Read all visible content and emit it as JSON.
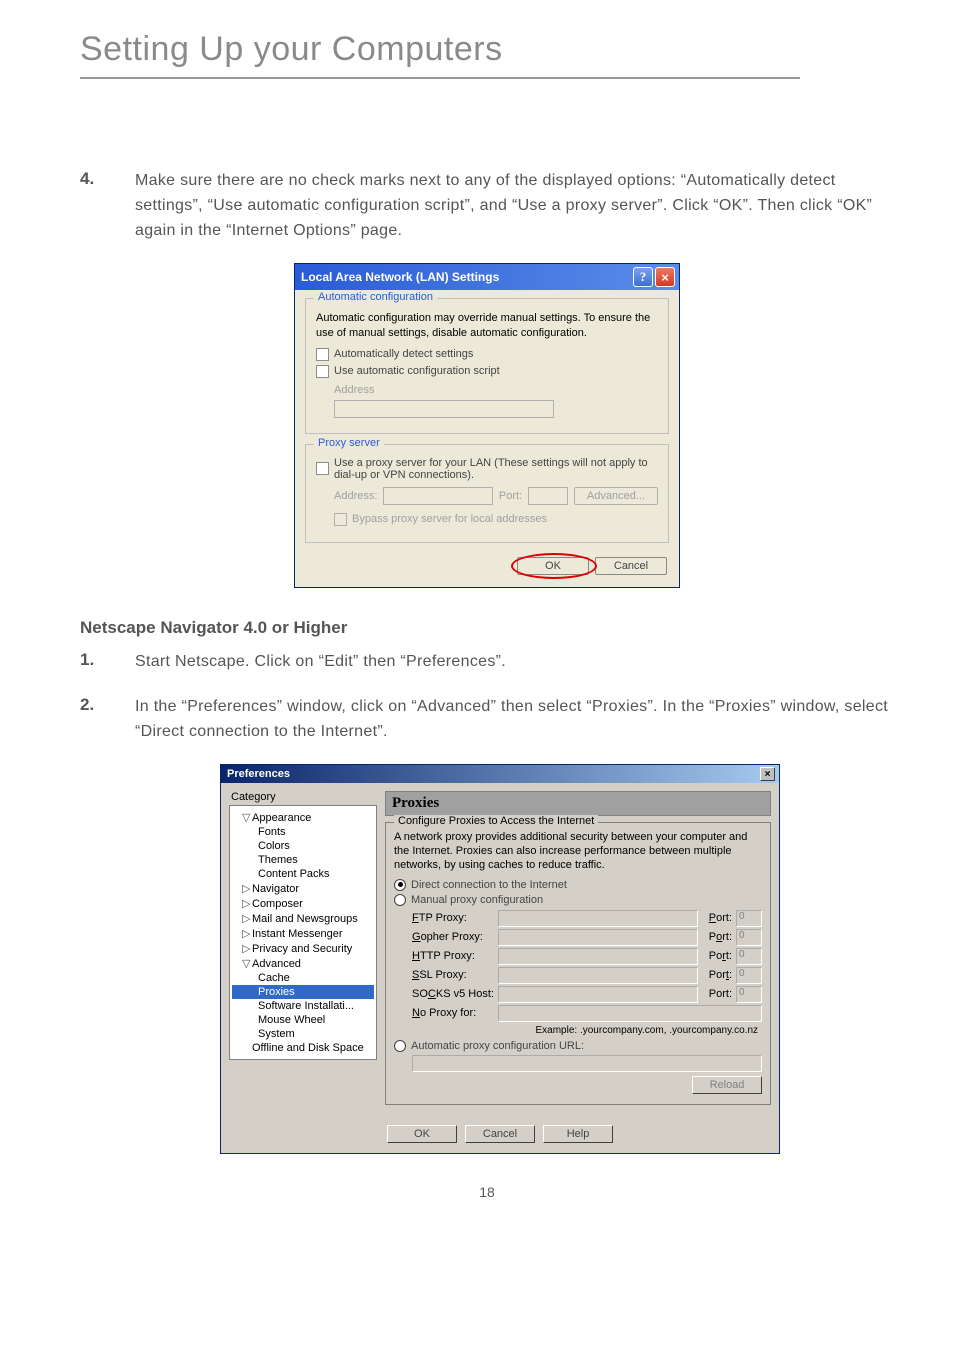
{
  "page": {
    "title": "Setting Up your Computers",
    "number": "18"
  },
  "steps_a": {
    "num4": "4.",
    "text4": "Make sure there are no check marks next to any of the displayed options: “Automatically detect settings”, “Use automatic configuration script”, and “Use a proxy server”. Click “OK”. Then click “OK” again in the “Internet Options” page."
  },
  "section_heading": "Netscape Navigator 4.0 or Higher",
  "steps_b": {
    "num1": "1.",
    "text1": "Start Netscape. Click on “Edit” then “Preferences”.",
    "num2": "2.",
    "text2": "In the “Preferences” window, click on “Advanced” then select “Proxies”. In the “Proxies” window, select “Direct connection to the Internet”."
  },
  "lan": {
    "title": "Local Area Network (LAN) Settings",
    "legend1": "Automatic configuration",
    "cfg_text": "Automatic configuration may override manual settings.  To ensure the use of manual settings, disable automatic configuration.",
    "auto_detect": "Automatically detect settings",
    "use_script": "Use automatic configuration script",
    "address_label": "Address",
    "legend2": "Proxy server",
    "proxy_text": "Use a proxy server for your LAN (These settings will not apply to dial-up or VPN connections).",
    "addr2": "Address:",
    "port": "Port:",
    "advanced": "Advanced...",
    "bypass": "Bypass proxy server for local addresses",
    "ok": "OK",
    "cancel": "Cancel"
  },
  "prefs": {
    "title": "Preferences",
    "tree_header": "Category",
    "tree": {
      "appearance": "Appearance",
      "fonts": "Fonts",
      "colors": "Colors",
      "themes": "Themes",
      "content_packs": "Content Packs",
      "navigator": "Navigator",
      "composer": "Composer",
      "mail": "Mail and Newsgroups",
      "im": "Instant Messenger",
      "privacy": "Privacy and Security",
      "advanced": "Advanced",
      "cache": "Cache",
      "proxies": "Proxies",
      "software": "Software Installati...",
      "mouse": "Mouse Wheel",
      "system": "System",
      "offline": "Offline and Disk Space"
    },
    "pane_title": "Proxies",
    "inner_legend": "Configure Proxies to Access the Internet",
    "desc": "A network proxy provides additional security between your computer and the Internet. Proxies can also increase performance between multiple networks, by using caches to reduce traffic.",
    "direct": "Direct connection to the Internet",
    "manual": "Manual proxy configuration",
    "ftp": "FTP Proxy:",
    "gopher": "Gopher Proxy:",
    "http": "HTTP Proxy:",
    "ssl": "SSL Proxy:",
    "socks": "SOCKS v5 Host:",
    "noproxy": "No Proxy for:",
    "port": "Port:",
    "port_val": "0",
    "example": "Example: .yourcompany.com, .yourcompany.co.nz",
    "autourl": "Automatic proxy configuration URL:",
    "reload": "Reload",
    "ok": "OK",
    "cancel": "Cancel",
    "help": "Help"
  }
}
